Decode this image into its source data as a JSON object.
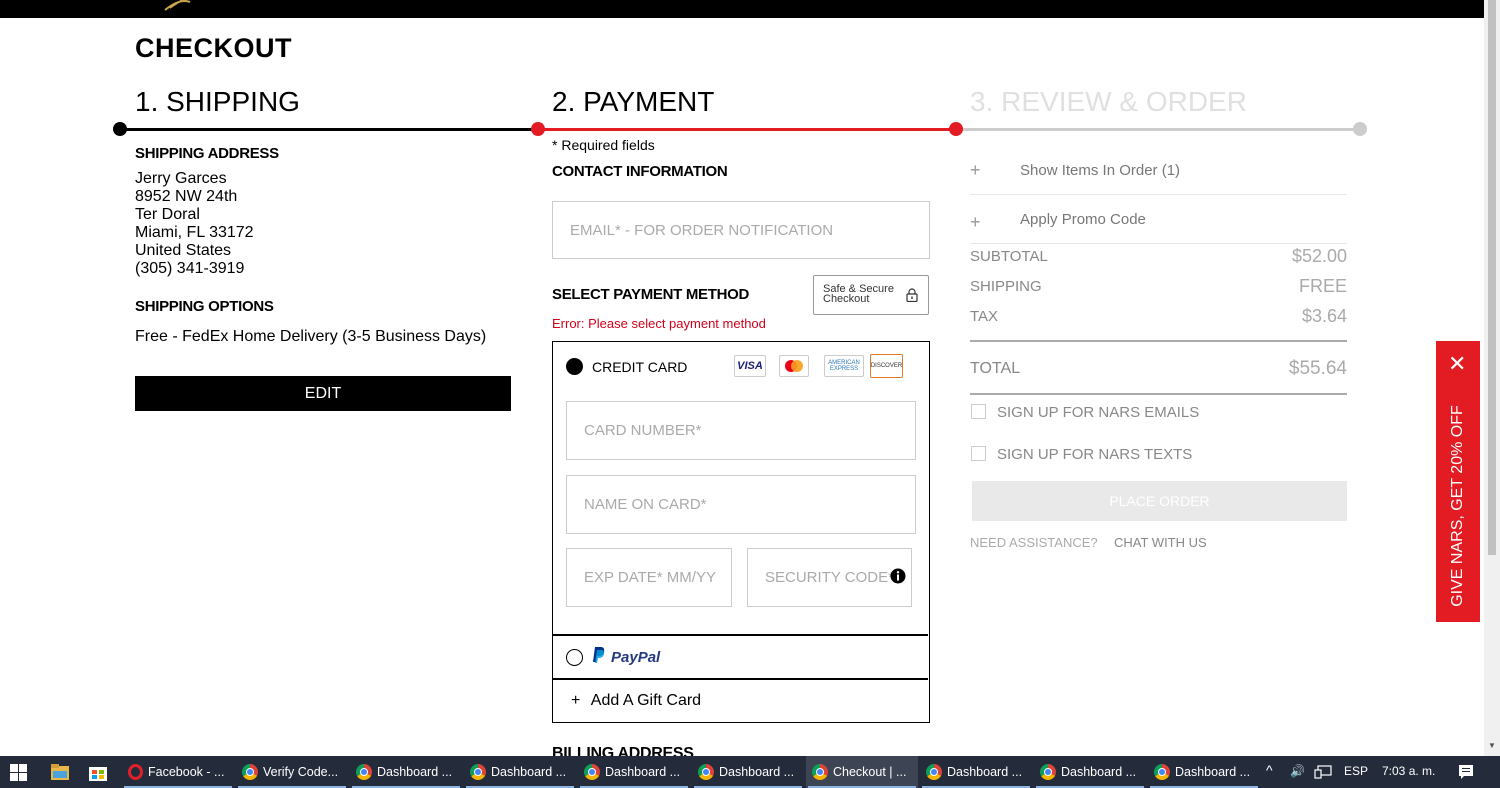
{
  "page": {
    "title": "CHECKOUT",
    "steps": [
      "1. SHIPPING",
      "2. PAYMENT",
      "3. REVIEW & ORDER"
    ]
  },
  "shipping": {
    "address_heading": "SHIPPING ADDRESS",
    "address_lines": [
      "Jerry Garces",
      "8952 NW 24th",
      "Ter Doral",
      "Miami, FL 33172",
      "United States",
      "(305) 341-3919"
    ],
    "options_heading": "SHIPPING OPTIONS",
    "option": "Free - FedEx Home Delivery (3-5 Business Days)",
    "edit_label": "EDIT"
  },
  "payment": {
    "required_mark": "*",
    "required_text": "Required fields",
    "contact_heading": "CONTACT INFORMATION",
    "email_placeholder": "EMAIL* - FOR ORDER NOTIFICATION",
    "method_heading": "SELECT PAYMENT METHOD",
    "secure_line1": "Safe & Secure",
    "secure_line2": "Checkout",
    "error": "Error: Please select payment method",
    "credit_card_label": "CREDIT CARD",
    "card_logos": [
      "VISA",
      "mastercard",
      "AMERICAN EXPRESS",
      "DISCOVER"
    ],
    "card_number_placeholder": "CARD NUMBER*",
    "name_on_card_placeholder": "NAME ON CARD*",
    "exp_placeholder": "EXP DATE* MM/YY",
    "security_placeholder": "SECURITY CODE*",
    "paypal_label": "PayPal",
    "gift_plus": "+",
    "gift_label": "Add A Gift Card",
    "billing_heading": "BILLING ADDRESS"
  },
  "summary": {
    "show_items": "Show Items In Order (1)",
    "promo": "Apply Promo Code",
    "subtotal_label": "SUBTOTAL",
    "subtotal_value": "$52.00",
    "shipping_label": "SHIPPING",
    "shipping_value": "FREE",
    "tax_label": "TAX",
    "tax_value": "$3.64",
    "total_label": "TOTAL",
    "total_value": "$55.64",
    "emails_label": "SIGN UP FOR NARS EMAILS",
    "texts_label": "SIGN UP FOR NARS TEXTS",
    "place_order": "PLACE ORDER",
    "assist_label": "NEED ASSISTANCE?",
    "chat_label": "CHAT WITH US"
  },
  "promo_tab": {
    "text": "GIVE NARS, GET 20% OFF",
    "close": "✕"
  },
  "taskbar": {
    "items": [
      "Facebook - ...",
      "Verify Code...",
      "Dashboard ...",
      "Dashboard ...",
      "Dashboard ...",
      "Dashboard ...",
      "Checkout | ...",
      "Dashboard ...",
      "Dashboard ...",
      "Dashboard ..."
    ],
    "lang": "ESP",
    "time": "7:03 a. m."
  },
  "colors": {
    "accent": "#e31b23",
    "progress_done": "#000000",
    "progress_active": "#e31b23",
    "progress_pending": "#cccccc",
    "error": "#d0021b"
  }
}
